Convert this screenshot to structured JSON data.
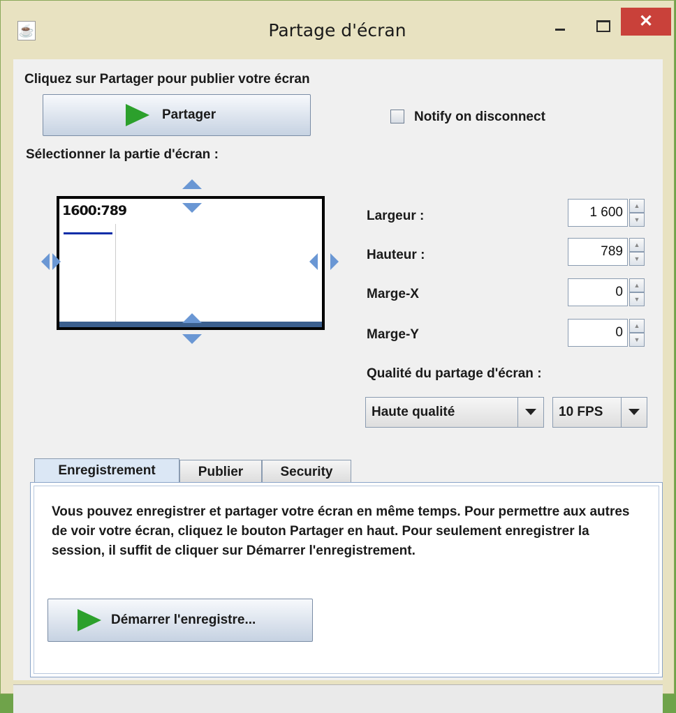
{
  "window": {
    "title": "Partage d'écran",
    "icon": "java-cup-icon",
    "close_symbol": "✕"
  },
  "share": {
    "instruction": "Cliquez sur Partager pour publier votre écran",
    "button_label": "Partager",
    "notify_label": "Notify on disconnect",
    "notify_checked": false
  },
  "region": {
    "label": "Sélectionner la partie d'écran :",
    "coords": "1600:789"
  },
  "fields": {
    "width_label": "Largeur :",
    "width_value": "1 600",
    "height_label": "Hauteur :",
    "height_value": "789",
    "marginx_label": "Marge-X",
    "marginx_value": "0",
    "marginy_label": "Marge-Y",
    "marginy_value": "0"
  },
  "quality": {
    "label": "Qualité du partage d'écran :",
    "quality_value": "Haute qualité",
    "fps_value": "10 FPS"
  },
  "tabs": [
    {
      "label": "Enregistrement",
      "active": true
    },
    {
      "label": "Publier",
      "active": false
    },
    {
      "label": "Security",
      "active": false
    }
  ],
  "record": {
    "description": "Vous pouvez enregistrer et partager votre écran en même temps. Pour permettre aux autres de voir votre écran, cliquez le bouton Partager en haut. Pour seulement enregistrer la session, il suffit de cliquer sur Démarrer l'enregistrement.",
    "button_label": "Démarrer l'enregistre..."
  },
  "colors": {
    "accent": "#2ca02c",
    "arrow": "#6a97d4",
    "close": "#c9413a"
  }
}
